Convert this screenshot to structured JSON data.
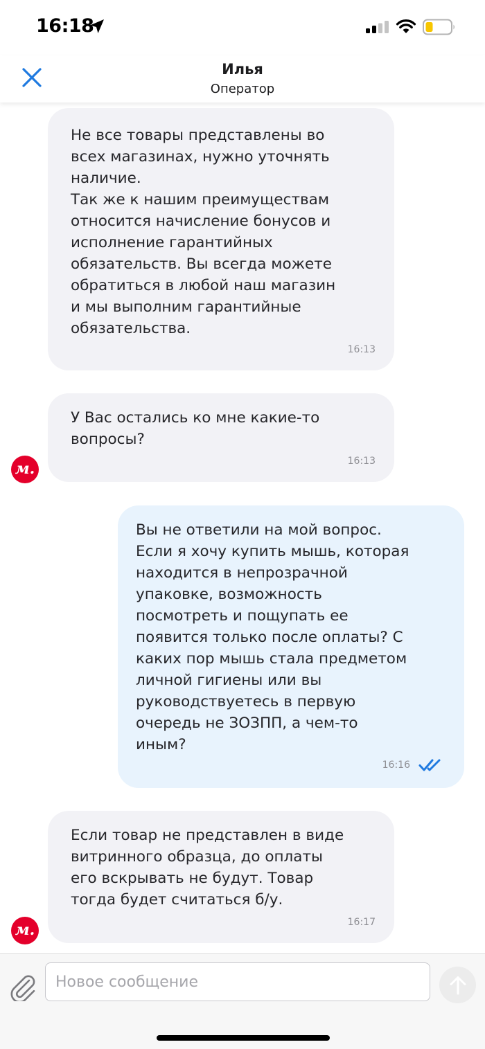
{
  "status_bar": {
    "time": "16:18"
  },
  "header": {
    "name": "Илья",
    "role": "Оператор"
  },
  "messages": [
    {
      "direction": "incoming",
      "text": "Не все товары представлены во\nвсех магазинах, нужно уточнять\nналичие.\nТак же к нашим преимуществам\nотносится начисление бонусов и\nисполнение гарантийных\nобязательств.  Вы всегда можете\nобратиться в любой наш магазин\nи мы выполним гарантийные\nобязательства.",
      "time": "16:13"
    },
    {
      "direction": "incoming",
      "text": "У Вас остались ко мне какие-то\nвопросы?",
      "time": "16:13",
      "avatar": "м."
    },
    {
      "direction": "outgoing",
      "text": "Вы не ответили на мой вопрос.\nЕсли я хочу купить мышь, которая\nнаходится в непрозрачной\nупаковке, возможность\nпосмотреть и пощупать ее\nпоявится только после оплаты? С\nкаких пор мышь стала предметом\nличной гигиены или вы\nруководствуетесь в первую\nочередь не ЗОЗПП, а чем-то\nиным?",
      "time": "16:16",
      "status_icon": "double-check-icon"
    },
    {
      "direction": "incoming",
      "text": "Если товар не представлен в виде\nвитринного образца,  до оплаты\nего вскрывать не будут.  Товар\nтогда будет считаться б/у.",
      "time": "16:17",
      "avatar": "м."
    }
  ],
  "input": {
    "placeholder": "Новое сообщение"
  },
  "icons": {
    "close": "close-icon",
    "attach": "paperclip-icon",
    "send": "arrow-up-icon",
    "read": "double-check-icon"
  },
  "colors": {
    "accent": "#1f7ae0",
    "incoming_bubble": "#f2f2f6",
    "outgoing_bubble": "#e8f3fd",
    "avatar_brand": "#e4002b",
    "battery_low": "#f7c600"
  }
}
